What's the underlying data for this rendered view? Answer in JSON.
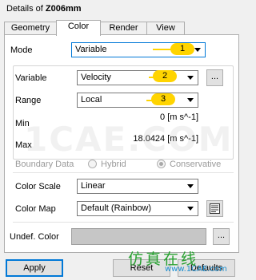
{
  "title": {
    "prefix": "Details of ",
    "object": "Z006mm"
  },
  "tabs": [
    {
      "label": "Geometry",
      "active": false
    },
    {
      "label": "Color",
      "active": true
    },
    {
      "label": "Render",
      "active": false
    },
    {
      "label": "View",
      "active": false
    }
  ],
  "mode": {
    "label": "Mode",
    "value": "Variable"
  },
  "variable": {
    "label": "Variable",
    "value": "Velocity",
    "more_label": "..."
  },
  "range": {
    "label": "Range",
    "value": "Local"
  },
  "min": {
    "label": "Min",
    "value": "0 [m s^-1]"
  },
  "max": {
    "label": "Max",
    "value": "18.0424 [m s^-1]"
  },
  "boundary_data": {
    "label": "Boundary Data",
    "options": [
      {
        "label": "Hybrid",
        "selected": false
      },
      {
        "label": "Conservative",
        "selected": true
      }
    ]
  },
  "color_scale": {
    "label": "Color Scale",
    "value": "Linear"
  },
  "color_map": {
    "label": "Color Map",
    "value": "Default (Rainbow)",
    "icon": "color-map-editor-icon"
  },
  "undef_color": {
    "label": "Undef. Color",
    "color": "#c6c6c6",
    "more_label": "..."
  },
  "buttons": {
    "apply": "Apply",
    "reset": "Reset",
    "defaults": "Defaults"
  },
  "annotations": [
    "1",
    "2",
    "3"
  ],
  "watermark": {
    "text": "1CAE.COM",
    "logo": "仿真在线",
    "url": "www.1CAE.com"
  },
  "colors": {
    "accent": "#0078d7",
    "badge": "#ffd400"
  }
}
